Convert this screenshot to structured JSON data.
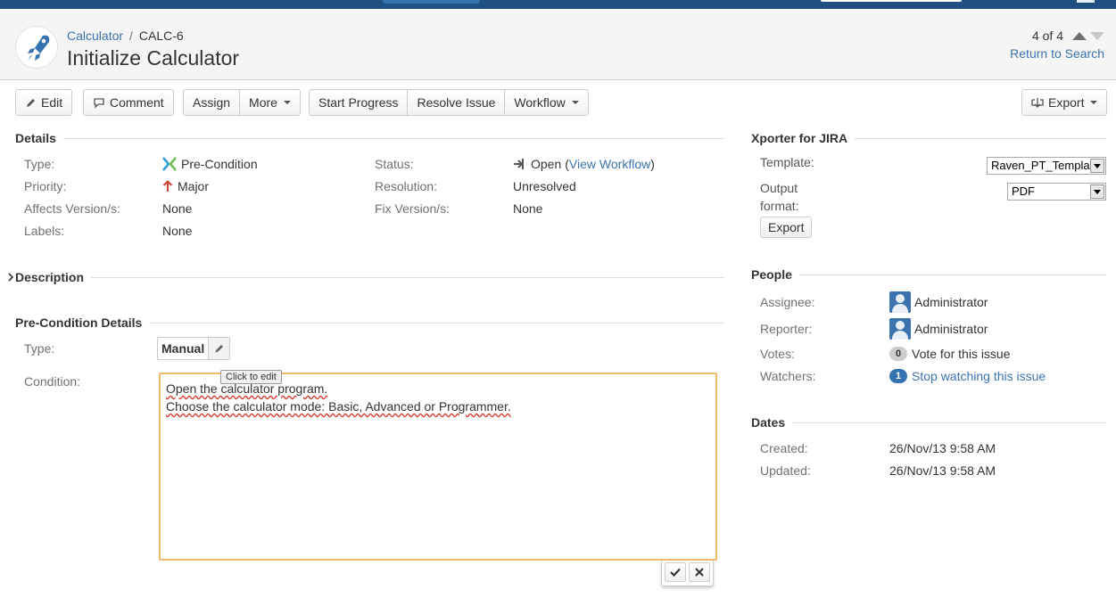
{
  "header": {
    "breadcrumb_project": "Calculator",
    "breadcrumb_sep": "/",
    "issue_key": "CALC-6",
    "summary": "Initialize Calculator",
    "pager_count": "4 of 4",
    "return_link": "Return to Search"
  },
  "toolbar": {
    "edit": "Edit",
    "comment": "Comment",
    "assign": "Assign",
    "more": "More",
    "start_progress": "Start Progress",
    "resolve_issue": "Resolve Issue",
    "workflow": "Workflow",
    "export": "Export"
  },
  "details": {
    "title": "Details",
    "type_label": "Type:",
    "type_value": "Pre-Condition",
    "priority_label": "Priority:",
    "priority_value": "Major",
    "affects_label": "Affects Version/s:",
    "affects_value": "None",
    "labels_label": "Labels:",
    "labels_value": "None",
    "status_label": "Status:",
    "status_value": "Open",
    "status_paren_open": "(",
    "view_workflow": "View Workflow",
    "status_paren_close": ")",
    "resolution_label": "Resolution:",
    "resolution_value": "Unresolved",
    "fix_label": "Fix Version/s:",
    "fix_value": "None"
  },
  "description": {
    "title": "Description"
  },
  "precondition": {
    "title": "Pre-Condition Details",
    "type_label": "Type:",
    "type_value": "Manual",
    "tooltip": "Click to edit",
    "condition_label": "Condition:",
    "condition_lines": [
      "Open the calculator program.",
      "Choose the calculator mode: Basic, Advanced or Programmer."
    ]
  },
  "xporter": {
    "title": "Xporter for JIRA",
    "template_label": "Template:",
    "template_value": "Raven_PT_Templa",
    "output_label_1": "Output",
    "output_label_2": "format:",
    "output_value": "PDF",
    "export_button": "Export"
  },
  "people": {
    "title": "People",
    "assignee_label": "Assignee:",
    "assignee_value": "Administrator",
    "reporter_label": "Reporter:",
    "reporter_value": "Administrator",
    "votes_label": "Votes:",
    "votes_count": "0",
    "votes_link": "Vote for this issue",
    "watchers_label": "Watchers:",
    "watchers_count": "1",
    "watchers_link": "Stop watching this issue"
  },
  "dates": {
    "title": "Dates",
    "created_label": "Created:",
    "created_value": "26/Nov/13 9:58 AM",
    "updated_label": "Updated:",
    "updated_value": "26/Nov/13 9:58 AM"
  },
  "colors": {
    "accent": "#3b73af",
    "topbar": "#205081",
    "focus_border": "#f0b96c"
  }
}
